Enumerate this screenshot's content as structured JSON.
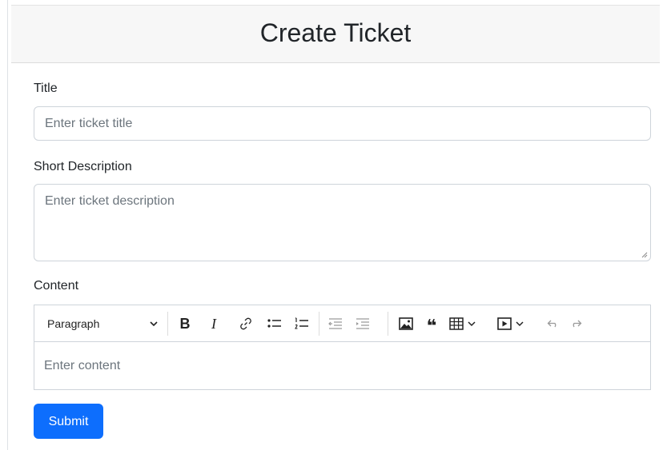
{
  "header": {
    "title": "Create Ticket"
  },
  "form": {
    "title_label": "Title",
    "title_placeholder": "Enter ticket title",
    "description_label": "Short Description",
    "description_placeholder": "Enter ticket description",
    "content_label": "Content",
    "content_placeholder": "Enter content",
    "submit_label": "Submit"
  },
  "editor": {
    "heading_value": "Paragraph",
    "toolbar_icons": [
      "bold-icon",
      "italic-icon",
      "link-icon",
      "bulleted-list-icon",
      "numbered-list-icon",
      "outdent-icon",
      "indent-icon",
      "image-icon",
      "blockquote-icon",
      "table-icon",
      "media-icon",
      "undo-icon",
      "redo-icon"
    ]
  },
  "colors": {
    "primary": "#0d6efd",
    "header_bg": "#f7f7f7",
    "border": "#ced4da",
    "placeholder": "#6c757d"
  }
}
